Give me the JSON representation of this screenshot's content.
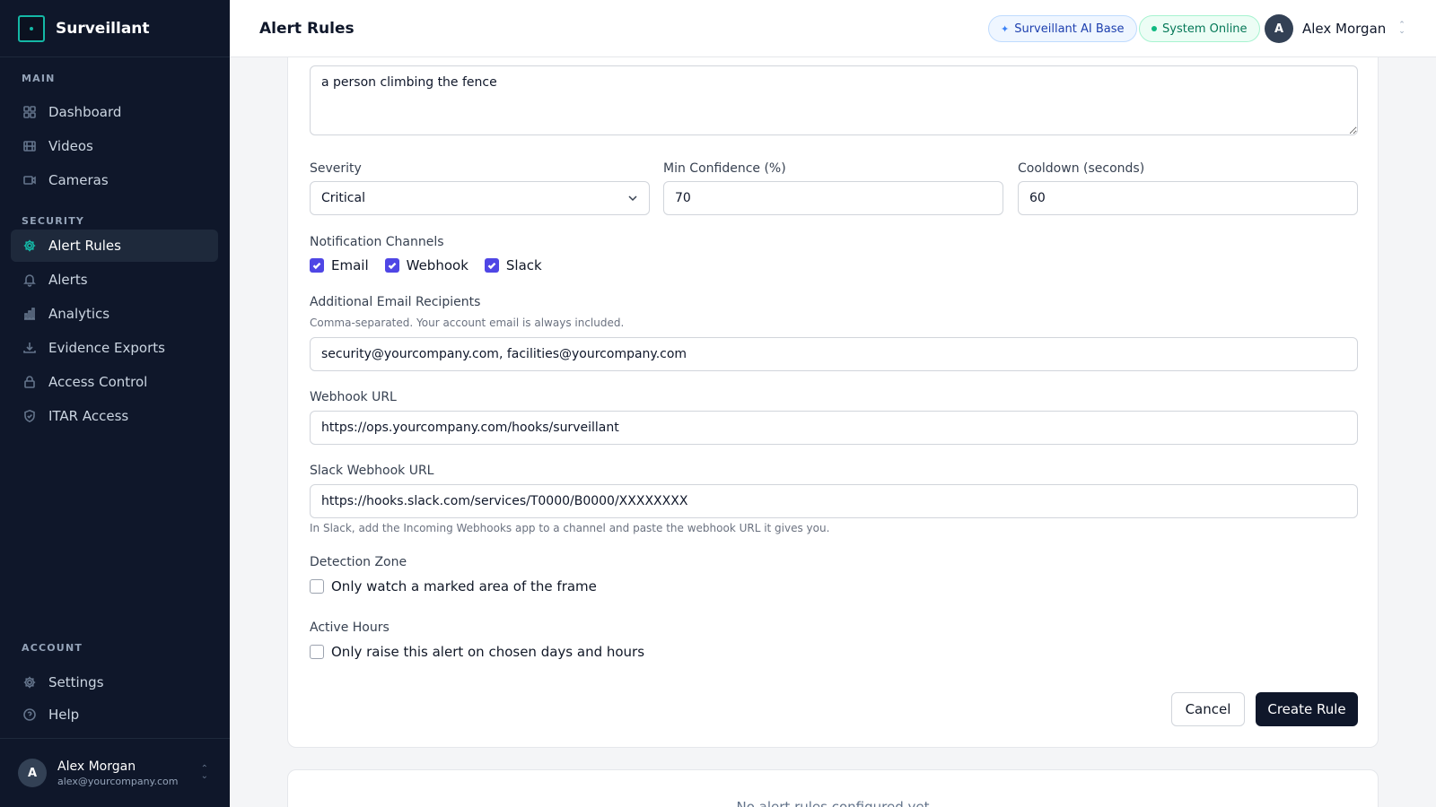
{
  "app": {
    "name": "Surveillant"
  },
  "sidebar": {
    "sections": {
      "main": "MAIN",
      "security": "SECURITY",
      "account": "ACCOUNT"
    },
    "items": [
      {
        "label": "Dashboard",
        "icon": "grid-icon"
      },
      {
        "label": "Videos",
        "icon": "film-icon"
      },
      {
        "label": "Cameras",
        "icon": "camera-icon"
      },
      {
        "label": "Alert Rules",
        "icon": "gear-icon",
        "active": true
      },
      {
        "label": "Alerts",
        "icon": "bell-icon"
      },
      {
        "label": "Analytics",
        "icon": "bar-chart-icon"
      },
      {
        "label": "Evidence Exports",
        "icon": "download-icon"
      },
      {
        "label": "Access Control",
        "icon": "lock-icon"
      },
      {
        "label": "ITAR Access",
        "icon": "shield-icon"
      },
      {
        "label": "Settings",
        "icon": "gear-icon"
      },
      {
        "label": "Help",
        "icon": "help-circle-icon"
      }
    ],
    "user": {
      "initial": "A",
      "name": "Alex Morgan",
      "email": "alex@yourcompany.com"
    }
  },
  "header": {
    "title": "Alert Rules",
    "ai_badge": "Surveillant AI Base",
    "status_badge": "System Online",
    "user": {
      "initial": "A",
      "name": "Alex Morgan"
    }
  },
  "form": {
    "description_value": "a person climbing the fence",
    "severity": {
      "label": "Severity",
      "value": "Critical"
    },
    "min_confidence": {
      "label": "Min Confidence (%)",
      "value": "70"
    },
    "cooldown": {
      "label": "Cooldown (seconds)",
      "value": "60"
    },
    "channels": {
      "label": "Notification Channels",
      "options": [
        {
          "label": "Email",
          "checked": true
        },
        {
          "label": "Webhook",
          "checked": true
        },
        {
          "label": "Slack",
          "checked": true
        }
      ]
    },
    "email_recipients": {
      "label": "Additional Email Recipients",
      "helper": "Comma-separated. Your account email is always included.",
      "value": "security@yourcompany.com, facilities@yourcompany.com"
    },
    "webhook_url": {
      "label": "Webhook URL",
      "value": "https://ops.yourcompany.com/hooks/surveillant"
    },
    "slack_webhook_url": {
      "label": "Slack Webhook URL",
      "value": "https://hooks.slack.com/services/T0000/B0000/XXXXXXXX",
      "helper": "In Slack, add the Incoming Webhooks app to a channel and paste the webhook URL it gives you."
    },
    "detection_zone": {
      "label": "Detection Zone",
      "option": "Only watch a marked area of the frame",
      "checked": false
    },
    "active_hours": {
      "label": "Active Hours",
      "option": "Only raise this alert on chosen days and hours",
      "checked": false
    },
    "cancel_label": "Cancel",
    "create_label": "Create Rule"
  },
  "rules_list": {
    "empty_text": "No alert rules configured yet"
  },
  "colors": {
    "sidebar_bg": "#0f172a",
    "accent_teal": "#14b8a6",
    "checkbox": "#4f46e5",
    "primary_button": "#0f172a"
  }
}
